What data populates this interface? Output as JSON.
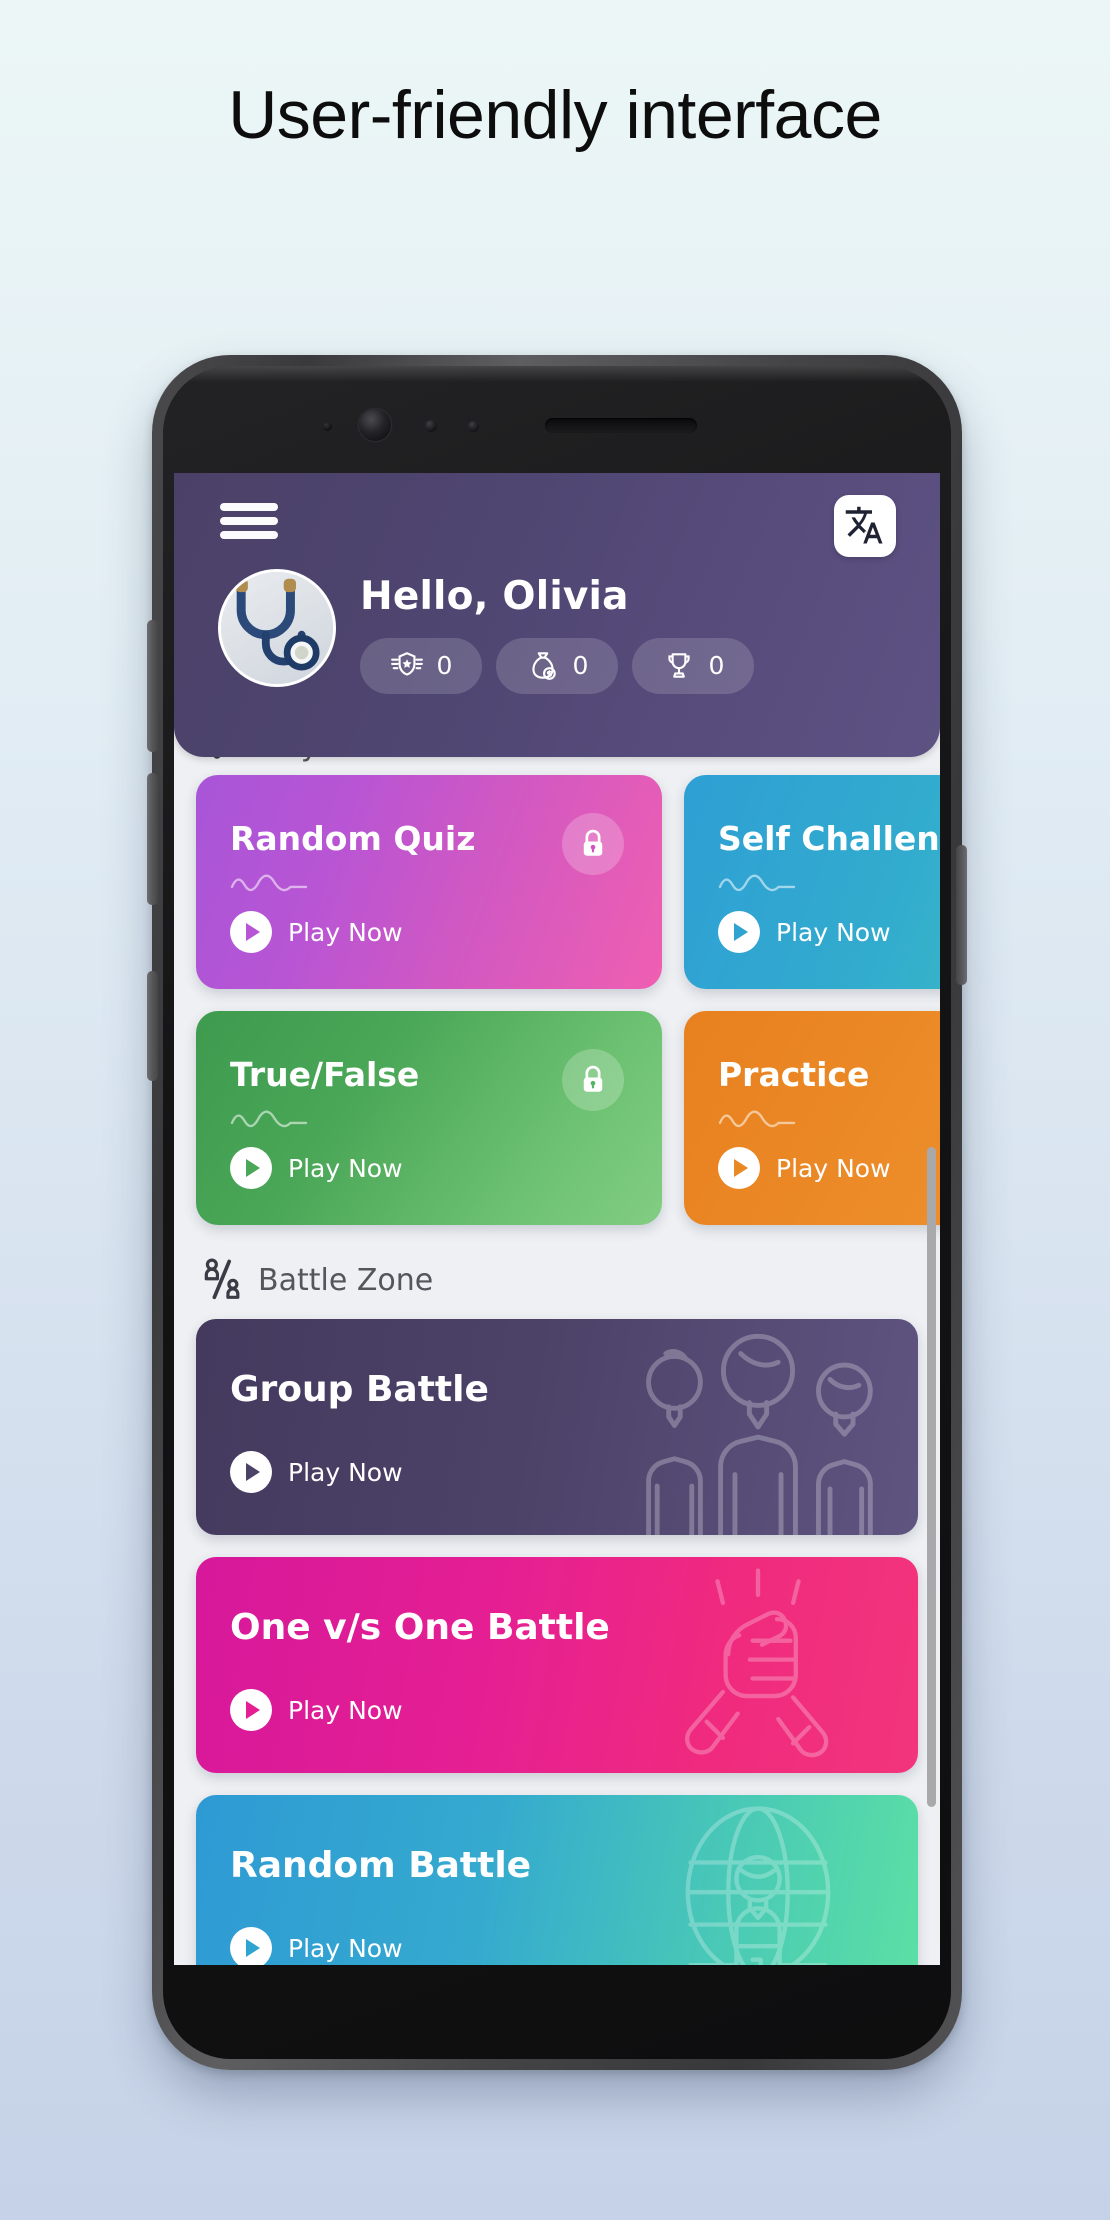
{
  "headline": "User-friendly interface",
  "phone": {
    "hardware": {
      "front_camera": "front-camera",
      "earpiece": "earpiece-speaker",
      "volume_up": "volume-up-button",
      "volume_down": "volume-down-button",
      "assistant": "assistant-button",
      "power": "power-button"
    }
  },
  "app": {
    "header": {
      "menu_icon": "hamburger-menu-icon",
      "language_icon": "translate-icon",
      "avatar_alt": "stethoscope-profile-photo",
      "greeting": "Hello, Olivia",
      "stats": [
        {
          "icon": "rank-badge-icon",
          "value": "0"
        },
        {
          "icon": "coin-bag-icon",
          "value": "0"
        },
        {
          "icon": "trophy-icon",
          "value": "0"
        }
      ],
      "accent": "#544a79"
    },
    "sections": [
      {
        "id": "play-zone",
        "title": "Play Zone",
        "icon": "check-mark-icon",
        "layout": "grid",
        "cards": [
          {
            "title": "Random Quiz",
            "cta": "Play Now",
            "locked": true,
            "color": "#d158c2",
            "gradient": "g-random",
            "art": "none"
          },
          {
            "title": "Self Challenge",
            "cta": "Play Now",
            "locked": false,
            "color": "#32abce",
            "gradient": "g-self",
            "art": "none"
          },
          {
            "title": "True/False",
            "cta": "Play Now",
            "locked": true,
            "color": "#4aa757",
            "gradient": "g-truefalse",
            "art": "none"
          },
          {
            "title": "Practice",
            "cta": "Play Now",
            "locked": false,
            "color": "#ec8b28",
            "gradient": "g-practice",
            "art": "none"
          }
        ]
      },
      {
        "id": "battle-zone",
        "title": "Battle Zone",
        "icon": "one-vs-one-icon",
        "layout": "list",
        "cards": [
          {
            "title": "Group Battle",
            "cta": "Play Now",
            "locked": false,
            "color": "#4c4268",
            "gradient": "g-group",
            "art": "three-people-art"
          },
          {
            "title": "One v/s One Battle",
            "cta": "Play Now",
            "locked": false,
            "color": "#e51f93",
            "gradient": "g-onevone",
            "art": "arm-wrestle-art"
          },
          {
            "title": "Random Battle",
            "cta": "Play Now",
            "locked": false,
            "color": "#35aacf",
            "gradient": "g-randomb",
            "art": "globe-podium-art"
          }
        ]
      }
    ],
    "scrollbar": {
      "name": "vertical-scrollbar"
    }
  }
}
